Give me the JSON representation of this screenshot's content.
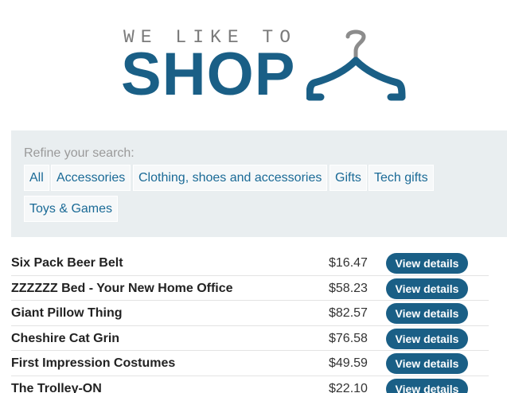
{
  "logo": {
    "tagline": "WE LIKE TO",
    "word": "SHOP",
    "icon": "hanger-icon",
    "colors": {
      "brand": "#1a5f86",
      "tagline": "#7a7a7a"
    }
  },
  "refine": {
    "label": "Refine your search:",
    "categories": [
      "All",
      "Accessories",
      "Clothing, shoes and accessories",
      "Gifts",
      "Tech gifts",
      "Toys & Games"
    ]
  },
  "products": [
    {
      "name": "Six Pack Beer Belt",
      "price": "$16.47",
      "button": "View details"
    },
    {
      "name": "ZZZZZZ Bed - Your New Home Office",
      "price": "$58.23",
      "button": "View details"
    },
    {
      "name": "Giant Pillow Thing",
      "price": "$82.57",
      "button": "View details"
    },
    {
      "name": "Cheshire Cat Grin",
      "price": "$76.58",
      "button": "View details"
    },
    {
      "name": "First Impression Costumes",
      "price": "$49.59",
      "button": "View details"
    },
    {
      "name": "The Trolley-ON",
      "price": "$22.10",
      "button": "View details"
    }
  ],
  "colors": {
    "accent": "#1a5f86",
    "link": "#1a6a96",
    "panel": "#e9eef0"
  }
}
